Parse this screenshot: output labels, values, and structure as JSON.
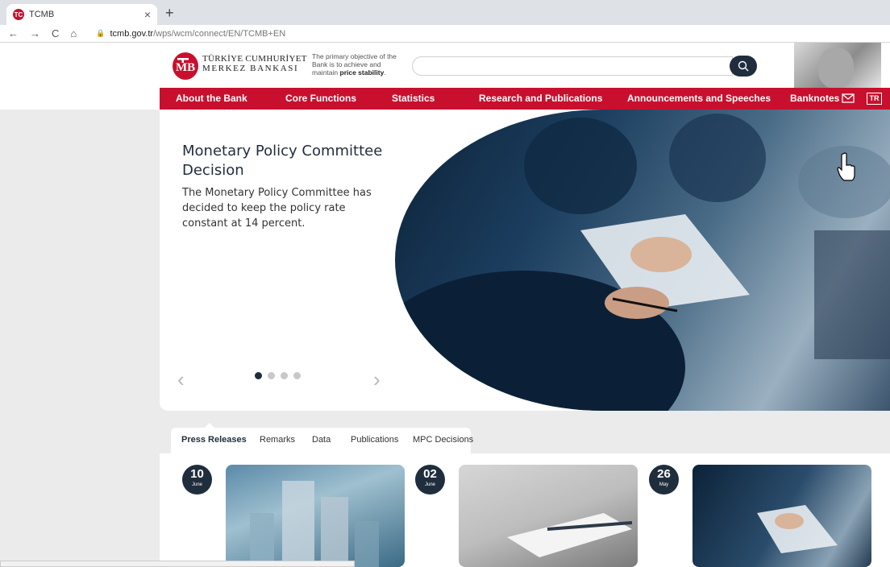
{
  "browser": {
    "tab_title": "TCMB",
    "tab_favicon_text": "TC",
    "close_label": "×",
    "new_tab_label": "+",
    "back_label": "←",
    "forward_label": "→",
    "reload_label": "C",
    "home_label": "⌂",
    "url_host": "tcmb.gov.tr",
    "url_path": "/wps/wcm/connect/EN/TCMB+EN"
  },
  "header": {
    "logo_mark": "TCMB",
    "logo_line1": "TÜRKİYE CUMHURİYET",
    "logo_line2": "MERKEZ BANKASI",
    "tagline_prefix": "The primary objective of the Bank is to achieve and maintain ",
    "tagline_bold": "price stability",
    "tagline_suffix": ".",
    "search_placeholder": ""
  },
  "nav": {
    "items": [
      "About the Bank",
      "Core Functions",
      "Statistics",
      "Research and Publications",
      "Announcements and Speeches",
      "Banknotes"
    ],
    "language": "TR"
  },
  "hero": {
    "title": "Monetary Policy Committee Decision",
    "text": "The Monetary Policy Committee has decided to keep the policy rate constant at 14 percent.",
    "prev_label": "‹",
    "next_label": "›",
    "slide_count": 4,
    "active_slide": 1
  },
  "news_tabs": {
    "items": [
      "Press Releases",
      "Remarks",
      "Data",
      "Publications",
      "MPC Decisions"
    ],
    "active": "Press Releases"
  },
  "news_cards": [
    {
      "day": "10",
      "month": "June"
    },
    {
      "day": "02",
      "month": "June"
    },
    {
      "day": "26",
      "month": "May"
    }
  ],
  "colors": {
    "brand_red": "#c8102e",
    "navy": "#1f2d3d"
  }
}
